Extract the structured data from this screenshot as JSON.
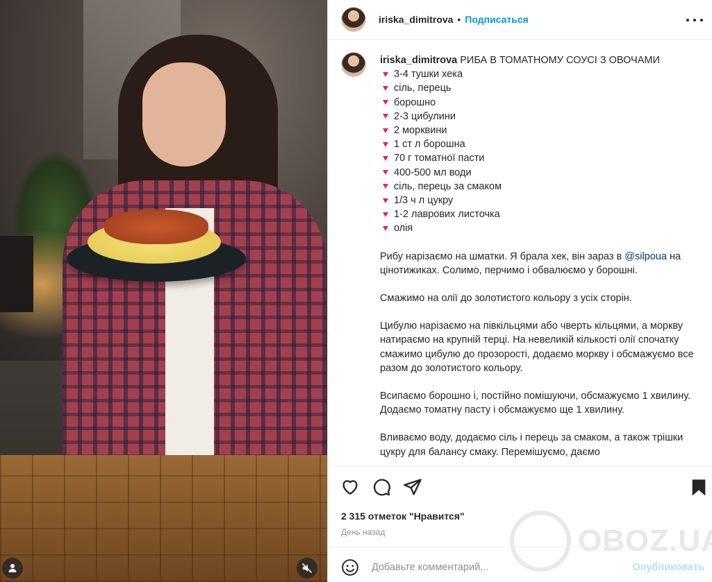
{
  "post": {
    "author": "iriska_dimitrova",
    "separator": "•",
    "follow_label": "Подписаться"
  },
  "caption": {
    "author": "iriska_dimitrova",
    "title": "РИБА В ТОМАТНОМУ СОУСІ З ОВОЧАМИ",
    "ingredients": [
      "3-4 тушки хека",
      "сіль, перець",
      "борошно",
      "2-3 цибулини",
      "2 морквини",
      "1 ст л борошна",
      "70 г томатної пасти",
      "400-500 мл води",
      "сіль, перець за смаком",
      "1/3 ч л цукру",
      "1-2 лаврових листочка",
      "олія"
    ],
    "p1_before": "Рибу нарізаємо на шматки. Я брала хек, він зараз в ",
    "p1_mention": "@silpoua",
    "p1_after": " на цінотижиках. Солимо, перчимо і обвалюємо у борошні.",
    "p2": "Смажимо на олії до золотистого кольору з усіх сторін.",
    "p3": "Цибулю нарізаємо на півкільцями або чверть кільцями, а моркву натираємо на крупній терці. На невеликій кількості олії спочатку смажимо цибулю до прозорості, додаємо моркву і обсмажуємо все разом до золотистого кольору.",
    "p4": "Всипаємо борошно і, постійно помішуючи, обсмажуємо 1 хвилину. Додаємо томатну пасту і обсмажуємо ще 1 хвилину.",
    "p5": "Вливаємо воду, додаємо сіль і перець за смаком, а також трішки цукру для балансу смаку. Перемішуємо, даємо"
  },
  "stats": {
    "likes": "2 315 отметок \"Нравится\"",
    "time": "День назад"
  },
  "comment_box": {
    "placeholder": "Добавьте комментарий...",
    "publish_label": "Опубликовать"
  },
  "watermark": {
    "text": "OBOZ.UA"
  },
  "icons": {
    "like": "heart-outline-icon",
    "comment": "comment-icon",
    "share": "paper-plane-icon",
    "save": "bookmark-filled-icon",
    "emoji": "smiley-icon",
    "more": "ellipsis-icon",
    "user_tag": "user-tag-icon",
    "mute": "speaker-muted-icon"
  },
  "colors": {
    "link_blue": "#0095f6",
    "bullet_heart": "#e0245e",
    "mention": "#00376b",
    "publish_disabled": "#b2dffc"
  }
}
